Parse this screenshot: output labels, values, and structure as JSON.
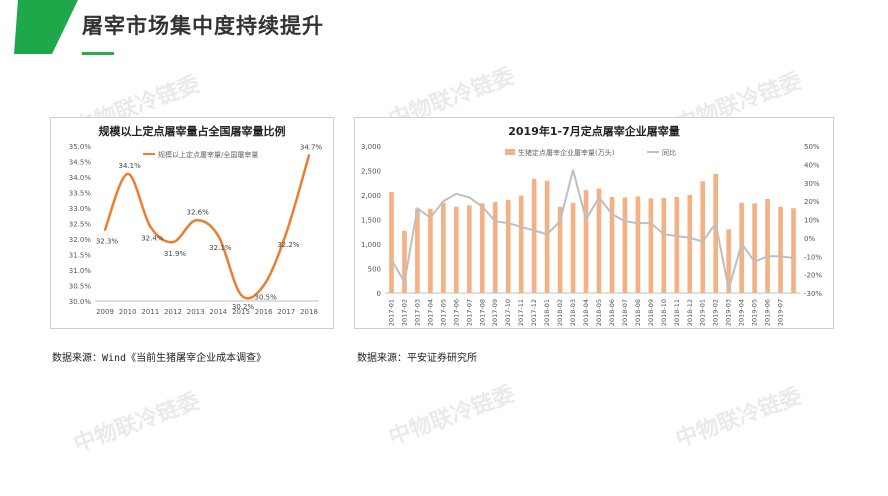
{
  "page": {
    "title": "屠宰市场集中度持续提升",
    "watermark": "中物联冷链委",
    "accent_color": "#2eaa4d"
  },
  "chart_data": [
    {
      "type": "line",
      "title": "规模以上定点屠宰量占全国屠宰量比例",
      "legend": "规模以上定点屠宰量/全国屠宰量",
      "x": [
        "2009",
        "2010",
        "2011",
        "2012",
        "2013",
        "2014",
        "2015",
        "2016",
        "2017",
        "2018"
      ],
      "values": [
        32.3,
        34.1,
        32.4,
        31.9,
        32.6,
        32.1,
        30.2,
        30.5,
        32.2,
        34.7
      ],
      "data_labels": [
        "32.3%",
        "34.1%",
        "32.4%",
        "31.9%",
        "32.6%",
        "32.1%",
        "30.2%",
        "30.5%",
        "32.2%",
        "34.7%"
      ],
      "ylim": [
        30.0,
        35.0
      ],
      "yticks": [
        "30.0%",
        "30.5%",
        "31.0%",
        "31.5%",
        "32.0%",
        "32.5%",
        "33.0%",
        "33.5%",
        "34.0%",
        "34.5%",
        "35.0%"
      ],
      "color": "#ed7d31",
      "smooth": true
    },
    {
      "type": "bar+line",
      "title": "2019年1-7月定点屠宰企业屠宰量",
      "categories": [
        "2017-01",
        "2017-02",
        "2017-03",
        "2017-04",
        "2017-05",
        "2017-06",
        "2017-07",
        "2017-08",
        "2017-09",
        "2017-10",
        "2017-11",
        "2017-12",
        "2018-01",
        "2018-02",
        "2018-03",
        "2018-04",
        "2018-05",
        "2018-06",
        "2018-07",
        "2018-08",
        "2018-09",
        "2018-10",
        "2018-11",
        "2018-12",
        "2019-01",
        "2019-02",
        "2019-03",
        "2019-04",
        "2019-05",
        "2019-06",
        "2019-07"
      ],
      "series": [
        {
          "name": "生猪定点屠宰企业屠宰量(万头)",
          "axis": "left",
          "color": "#f4b183",
          "values": [
            2060,
            1270,
            1720,
            1720,
            1840,
            1760,
            1790,
            1830,
            1860,
            1900,
            1990,
            2330,
            2290,
            1760,
            1840,
            2100,
            2130,
            1960,
            1950,
            1970,
            1930,
            1940,
            1960,
            2000,
            2280,
            2430,
            1300,
            1840,
            1830,
            1920,
            1760,
            1730
          ]
        },
        {
          "name": "同比",
          "axis": "right",
          "color": "#bfbfbf",
          "values": [
            -12,
            -24,
            16,
            11,
            20,
            24,
            22,
            17,
            9,
            8,
            6,
            4,
            2,
            9,
            37,
            10,
            22,
            13,
            9,
            8,
            8,
            2,
            1,
            0,
            -2,
            8,
            -28,
            -3,
            -13,
            -10,
            -10,
            -11
          ]
        }
      ],
      "y_left": {
        "range": [
          0,
          3000
        ],
        "ticks": [
          "0",
          "500",
          "1,000",
          "1,500",
          "2,000",
          "2,500",
          "3,000"
        ]
      },
      "y_right": {
        "range": [
          -30,
          50
        ],
        "ticks": [
          "-30%",
          "-20%",
          "-10%",
          "0%",
          "10%",
          "20%",
          "30%",
          "40%",
          "50%"
        ]
      }
    }
  ],
  "sources": {
    "left": "数据来源：Wind《当前生猪屠宰企业成本调查》",
    "right": "数据来源：平安证券研究所"
  }
}
